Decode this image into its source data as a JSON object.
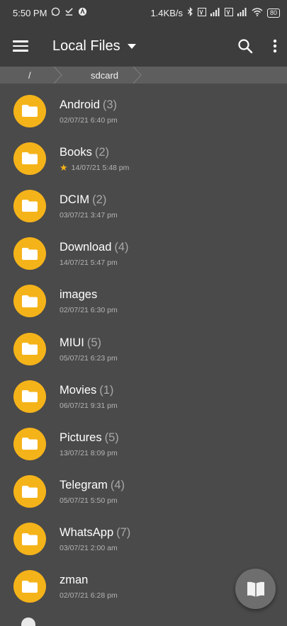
{
  "status_bar": {
    "time": "5:50 PM",
    "network_speed": "1.4KB/s",
    "battery": "80",
    "left_icons": [
      "whatsapp-icon",
      "download-done-icon",
      "app-icon"
    ],
    "right_icons": [
      "bluetooth-icon",
      "volte-icon",
      "signal-icon",
      "volte-icon",
      "signal-icon",
      "wifi-icon",
      "battery-icon"
    ]
  },
  "app_bar": {
    "title": "Local Files",
    "menu_icon": "hamburger-menu-icon",
    "search_icon": "search-icon",
    "overflow_icon": "more-vert-icon"
  },
  "breadcrumb": {
    "items": [
      "/",
      "sdcard"
    ]
  },
  "files": [
    {
      "name": "Android",
      "count": "(3)",
      "date": "02/07/21 6:40 pm",
      "starred": false
    },
    {
      "name": "Books",
      "count": "(2)",
      "date": "14/07/21 5:48 pm",
      "starred": true
    },
    {
      "name": "DCIM",
      "count": "(2)",
      "date": "03/07/21 3:47 pm",
      "starred": false
    },
    {
      "name": "Download",
      "count": "(4)",
      "date": "14/07/21 5:47 pm",
      "starred": false
    },
    {
      "name": "images",
      "count": "",
      "date": "02/07/21 6:30 pm",
      "starred": false
    },
    {
      "name": "MIUI",
      "count": "(5)",
      "date": "05/07/21 6:23 pm",
      "starred": false
    },
    {
      "name": "Movies",
      "count": "(1)",
      "date": "06/07/21 9:31 pm",
      "starred": false
    },
    {
      "name": "Pictures",
      "count": "(5)",
      "date": "13/07/21 8:09 pm",
      "starred": false
    },
    {
      "name": "Telegram",
      "count": "(4)",
      "date": "05/07/21 5:50 pm",
      "starred": false
    },
    {
      "name": "WhatsApp",
      "count": "(7)",
      "date": "03/07/21 2:00 am",
      "starred": false
    },
    {
      "name": "zman",
      "count": "",
      "date": "02/07/21 6:28 pm",
      "starred": false
    }
  ],
  "fab": {
    "icon": "open-book-icon"
  },
  "colors": {
    "background": "#4a4a4a",
    "app_bar": "#3d3d3d",
    "breadcrumb": "#5e5e5e",
    "folder": "#f5b31a",
    "secondary_text": "#b4b4b4"
  }
}
